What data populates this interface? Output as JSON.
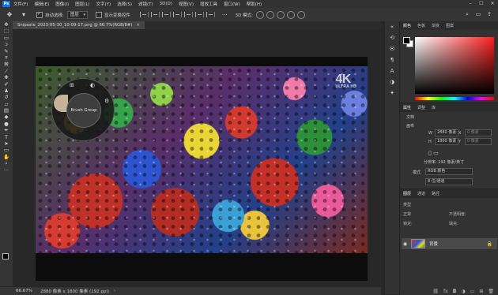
{
  "menu": {
    "items": [
      "文件(F)",
      "编辑(E)",
      "图像(I)",
      "图层(L)",
      "文字(Y)",
      "选择(S)",
      "滤镜(T)",
      "3D(D)",
      "视图(V)",
      "增效工具",
      "窗口(W)",
      "帮助(H)"
    ]
  },
  "options": {
    "auto_select_label": "自动选择:",
    "auto_select_value": "图层",
    "show_transform_label": "显示变换控件",
    "mode_3d_label": "3D 模式:"
  },
  "document": {
    "tab_title": "Snipaste_2023-05-30_10-09-17.png @ 66.7%(RGB/8#)",
    "badge": "4K",
    "badge_sub": "ULTRA HD"
  },
  "brush_wheel": {
    "label": "Brush Group"
  },
  "status": {
    "zoom": "66.67%",
    "info": "2880 像素 x 1800 像素 (192 ppi)",
    "arrow": "›"
  },
  "color_panel": {
    "tabs": [
      "颜色",
      "色板",
      "渐变",
      "图案"
    ]
  },
  "properties": {
    "tabs": [
      "属性",
      "调整",
      "库"
    ],
    "doc_label": "文档",
    "canvas_label": "画布",
    "w_label": "W",
    "w_value": "2880 像素",
    "h_label": "H",
    "h_value": "1800 像素",
    "x_label": "X",
    "y_label": "Y",
    "x_value": "0 像素",
    "y_value": "0 像素",
    "resolution": "分辨率: 192 像素/英寸",
    "mode_label": "模式",
    "mode_value": "RGB 颜色",
    "depth_value": "8 位/通道"
  },
  "layers_panel": {
    "tabs": [
      "图层",
      "通道",
      "路径"
    ],
    "kind_label": "类型",
    "blend_label": "正常",
    "opacity_label": "不透明度:",
    "lock_label": "锁定:",
    "fill_label": "填充:",
    "layer_name": "背景"
  },
  "colors": {
    "accent": "#1473e6",
    "app_bg": "#282828",
    "panel_bg": "#323232"
  }
}
